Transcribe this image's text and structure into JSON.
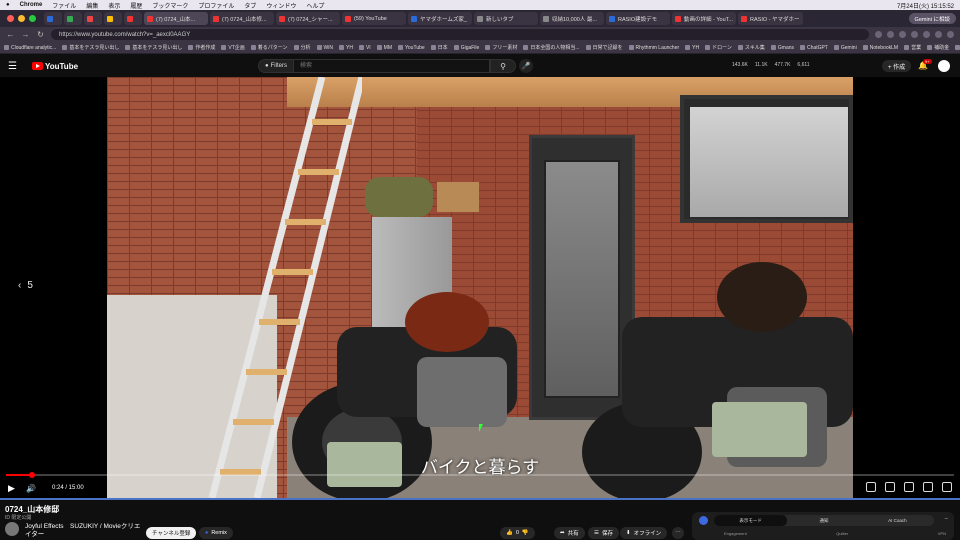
{
  "menubar": {
    "apple": "",
    "items": [
      "Chrome",
      "ファイル",
      "編集",
      "表示",
      "履歴",
      "ブックマーク",
      "プロファイル",
      "タブ",
      "ウィンドウ",
      "ヘルプ"
    ],
    "clock": "7月24日(火)  15:15:52"
  },
  "tabs": [
    {
      "label": "(7) 0724_山本...",
      "active": true
    },
    {
      "label": "(7) 0724_山本修..."
    },
    {
      "label": "(7) 0724_シャー..."
    },
    {
      "label": "(59) YouTube"
    },
    {
      "label": "ヤマダホームズ家_"
    },
    {
      "label": "新しいタブ"
    },
    {
      "label": "収納10,000人 最..."
    },
    {
      "label": "RASIO建設デモ"
    },
    {
      "label": "動画の詳細 - YouT..."
    },
    {
      "label": "RASIO - ヤマダホー"
    }
  ],
  "browser": {
    "gemini_label": "Gemini に相談",
    "url": "https://www.youtube.com/watch?v=_aexcl0AAGY"
  },
  "bookmarks": [
    "Cloudflare analytic...",
    "基本をテスラ見い出し",
    "基本をテスラ見い出し",
    "作者作成",
    "VT企画",
    "着るパターン",
    "分析",
    "WiN",
    "YH",
    "VI",
    "MM",
    "YouTube",
    "日本",
    "GigaFile",
    "フリー素材",
    "日本全国の人物相当...",
    "日常で記録を",
    "Rhythmm Launcher",
    "YH",
    "ドローン",
    "スキル集",
    "Gmans",
    "ChatGPT",
    "Gemini",
    "NotebookLM",
    "営業",
    "補助金",
    "便利サイト"
  ],
  "youtube": {
    "logo_text": "YouTube",
    "filters_label": "Filters",
    "search_placeholder": "検索",
    "stats": [
      "143.6K",
      "11.1K",
      "477.7K",
      "6,611"
    ],
    "create_label": "+ 作成",
    "notif_count": "9+"
  },
  "player": {
    "subtitle": "バイクと暮らす",
    "chapter_back": "5",
    "time_current": "0:24",
    "time_total": "15:00",
    "time_display": "0:24 / 15:00",
    "progress_fraction": 0.027
  },
  "video_info": {
    "title": "0724_山本修邸",
    "sub": "ID 限定公開",
    "channel": "Joyful Effects　SUZUKIY / Movieクリエイター",
    "subscribe_label": "チャンネル登録",
    "remix_label": "Remix",
    "like_count": "0",
    "share_label": "共有",
    "save_label": "保存",
    "offline_label": "オフライン",
    "more_label": "⋯"
  },
  "side_panel": {
    "tabs": [
      "表示モード",
      "通知",
      "AI Coach"
    ],
    "columns": [
      "Engagement",
      "Quitter",
      "VPN"
    ]
  }
}
